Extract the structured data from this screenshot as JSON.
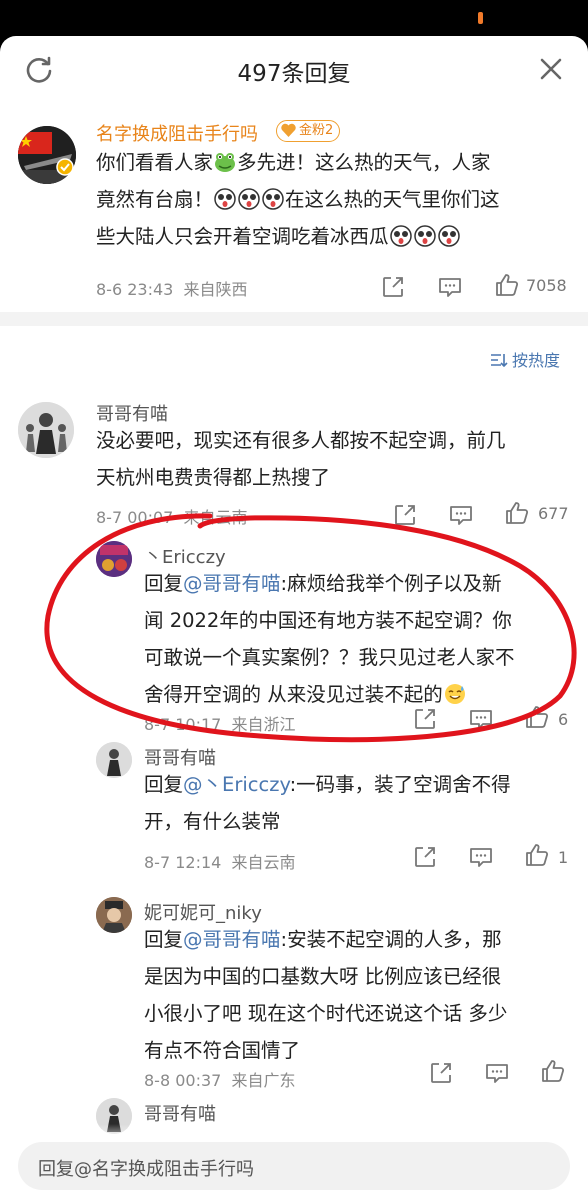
{
  "header": {
    "title": "497条回复"
  },
  "main_post": {
    "author": "名字换成阻击手行吗",
    "badge": "金粉2",
    "line1": "你们看看人家",
    "line1b": "多先进！这么热的天气，人家",
    "line2": "竟然有台扇！",
    "line2b": "在这么热的天气里你们这",
    "line3": "些大陆人只会开着空调吃着冰西瓜",
    "time": "8-6 23:43",
    "location": "来自陕西",
    "likes": "7058"
  },
  "sort_label": "按热度",
  "comments": [
    {
      "author": "哥哥有喵",
      "line1": "没必要吧，现实还有很多人都按不起空调，前几",
      "line2": "天杭州电费贵得都上热搜了",
      "time": "8-7 00:07",
      "location": "来自云南",
      "likes": "677"
    },
    {
      "author": "丶Ericczy",
      "prefix": "回复",
      "mention": "@哥哥有喵",
      "line1": ":麻烦给我举个例子以及新",
      "line2": "闻 2022年的中国还有地方装不起空调？你",
      "line3": "可敢说一个真实案例？？我只见过老人家不",
      "line4": "舍得开空调的 从来没见过装不起的",
      "time": "8-7 10:17",
      "location": "来自浙江",
      "likes": "6"
    },
    {
      "author": "哥哥有喵",
      "prefix": "回复",
      "mention": "@丶Ericczy",
      "line1": ":一码事，装了空调舍不得",
      "line2": "开，有什么装常",
      "time": "8-7 12:14",
      "location": "来自云南",
      "likes": "1"
    },
    {
      "author": "妮可妮可_niky",
      "prefix": "回复",
      "mention": "@哥哥有喵",
      "line1": ":安装不起空调的人多，那",
      "line2": "是因为中国的口基数大呀 比例应该已经很",
      "line3": "小很小了吧 现在这个时代还说这个话 多少",
      "line4": "有点不符合国情了",
      "time": "8-8 00:37",
      "location": "来自广东",
      "likes": ""
    },
    {
      "author": "哥哥有喵"
    }
  ],
  "reply_bar": {
    "placeholder": "回复@名字换成阻击手行吗"
  },
  "colors": {
    "accent": "#4a77b0",
    "author_orange": "#e8841a",
    "red_annotation": "#e0141c"
  },
  "icons": [
    "refresh-icon",
    "close-icon",
    "share-icon",
    "comment-icon",
    "like-icon",
    "sort-icon"
  ]
}
